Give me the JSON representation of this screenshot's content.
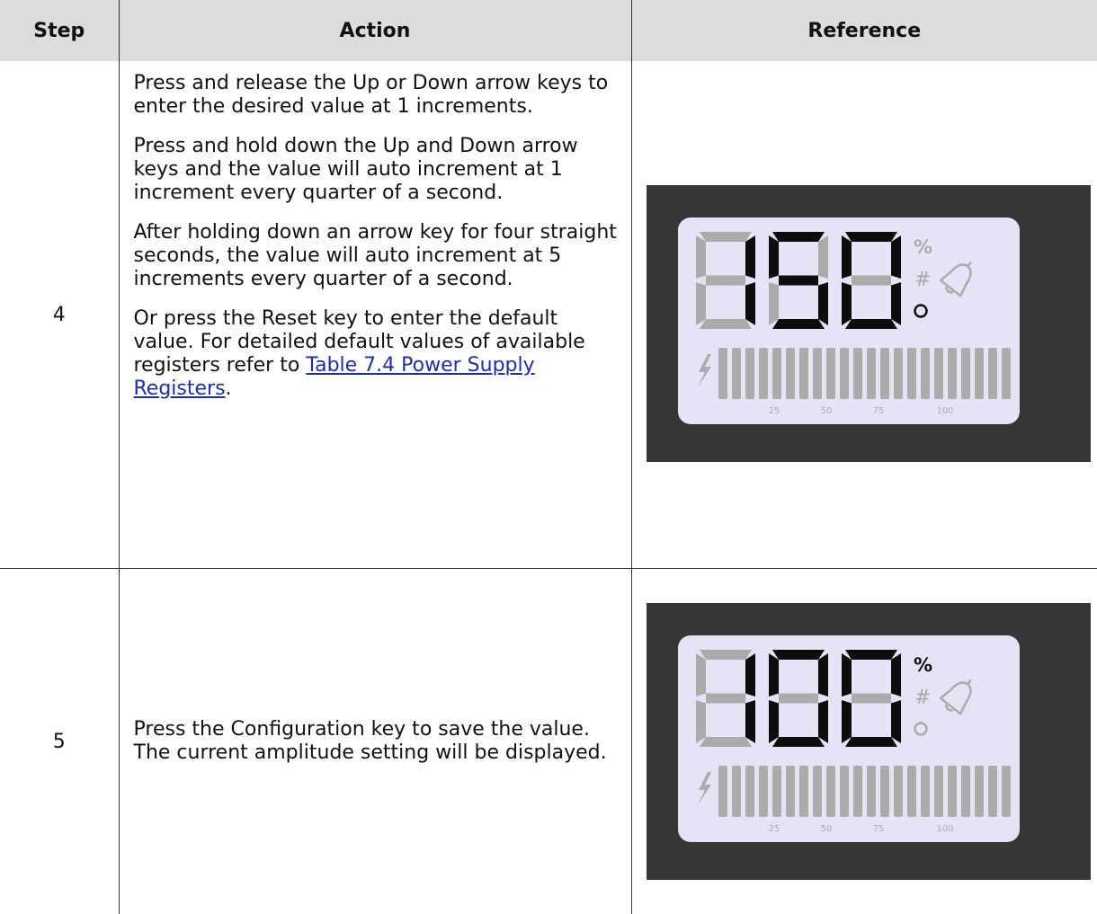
{
  "table": {
    "headers": [
      "Step",
      "Action",
      "Reference"
    ],
    "rows": [
      {
        "step": "4",
        "paragraphs": [
          "Press and release the Up or Down arrow keys to enter the desired value at 1 increments.",
          "Press and hold down the Up and Down arrow keys and the value will auto increment at 1 increment every quarter of a second.",
          "After holding down an arrow key for four straight seconds, the value will auto increment at 5 increments every quarter of a second."
        ],
        "last_paragraph_prefix": "Or press the Reset key to enter the default value. For detailed default values of available registers refer to ",
        "link_text": "Table 7.4 Power Supply Registers",
        "last_paragraph_suffix": "."
      },
      {
        "step": "5",
        "paragraphs": [
          "Press the Configuration key to save the value. The current amplitude setting will be displayed."
        ]
      }
    ]
  },
  "displays": [
    {
      "digits": "150",
      "active_indicators": [
        "o"
      ],
      "indicator_glyphs": {
        "percent": "%",
        "hash": "#",
        "o": "o"
      },
      "scale_labels": [
        "25",
        "50",
        "75",
        "100"
      ],
      "bar_segments": 22,
      "bar_active_segments": 0
    },
    {
      "digits": "100",
      "active_indicators": [
        "percent"
      ],
      "indicator_glyphs": {
        "percent": "%",
        "hash": "#",
        "o": "o"
      },
      "scale_labels": [
        "25",
        "50",
        "75",
        "100"
      ],
      "bar_segments": 22,
      "bar_active_segments": 0
    }
  ],
  "colors": {
    "header_bg": "#dcdcdc",
    "lcd_frame": "#363636",
    "lcd_panel": "#e6e3f6",
    "segment_on": "#0d0d0d",
    "segment_off": "#ababab",
    "link": "#1f2f9f"
  }
}
